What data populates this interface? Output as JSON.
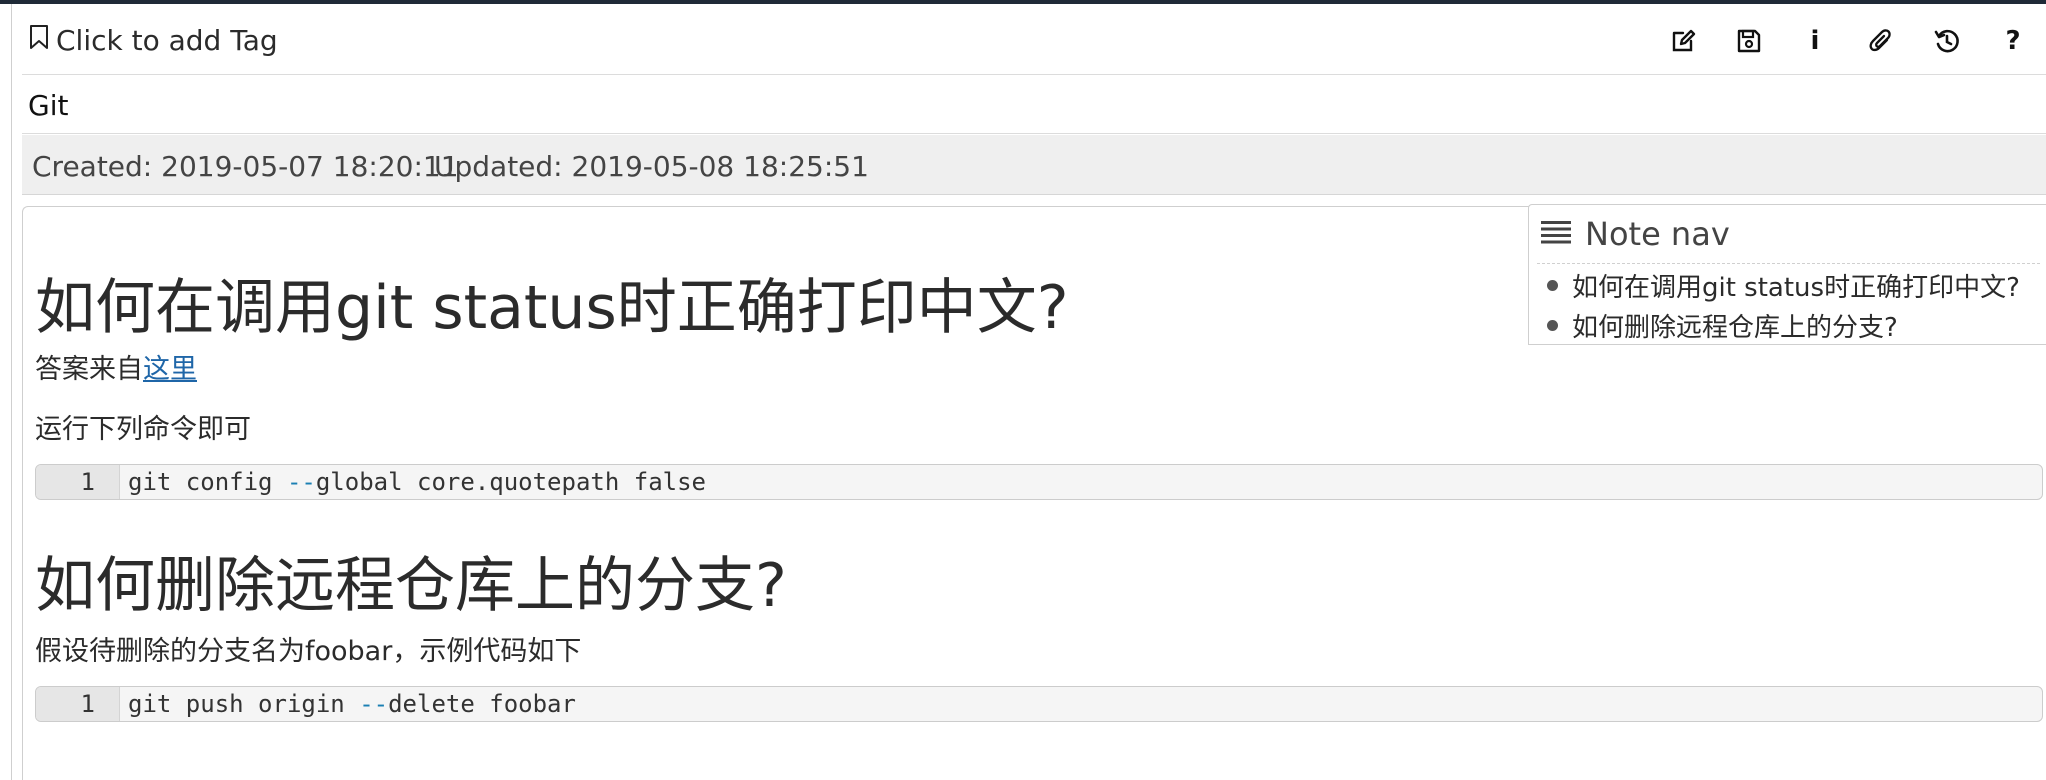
{
  "toolbar": {
    "tag_label": "Click to add Tag",
    "icons": [
      "edit-icon",
      "save-icon",
      "info-icon",
      "attachment-icon",
      "history-icon",
      "help-icon"
    ],
    "info_glyph": "i",
    "help_glyph": "?"
  },
  "note": {
    "title": "Git",
    "created": "Created: 2019-05-07 18:20:11",
    "updated": "Updated: 2019-05-08 18:25:51"
  },
  "content": {
    "heading_1": "如何在调用git status时正确打印中文?",
    "answer_prefix": "答案来自",
    "answer_link": "这里",
    "run_text": "运行下列命令即可",
    "code_1": {
      "line_number": "1",
      "before": "git config ",
      "option": "--",
      "after": "global core.quotepath false"
    },
    "heading_2": "如何删除远程仓库上的分支?",
    "assume_text": "假设待删除的分支名为foobar，示例代码如下",
    "code_2": {
      "line_number": "1",
      "before": "git push origin ",
      "option": "--",
      "after": "delete foobar"
    }
  },
  "note_nav": {
    "title": "Note nav",
    "items": [
      {
        "label": "如何在调用git status时正确打印中文?"
      },
      {
        "label": "如何删除远程仓库上的分支?"
      }
    ]
  },
  "colors": {
    "link": "#1f66a8",
    "code_option": "#1a7fb3",
    "meta_background": "#efefef",
    "top_strip": "#1f2a37"
  }
}
